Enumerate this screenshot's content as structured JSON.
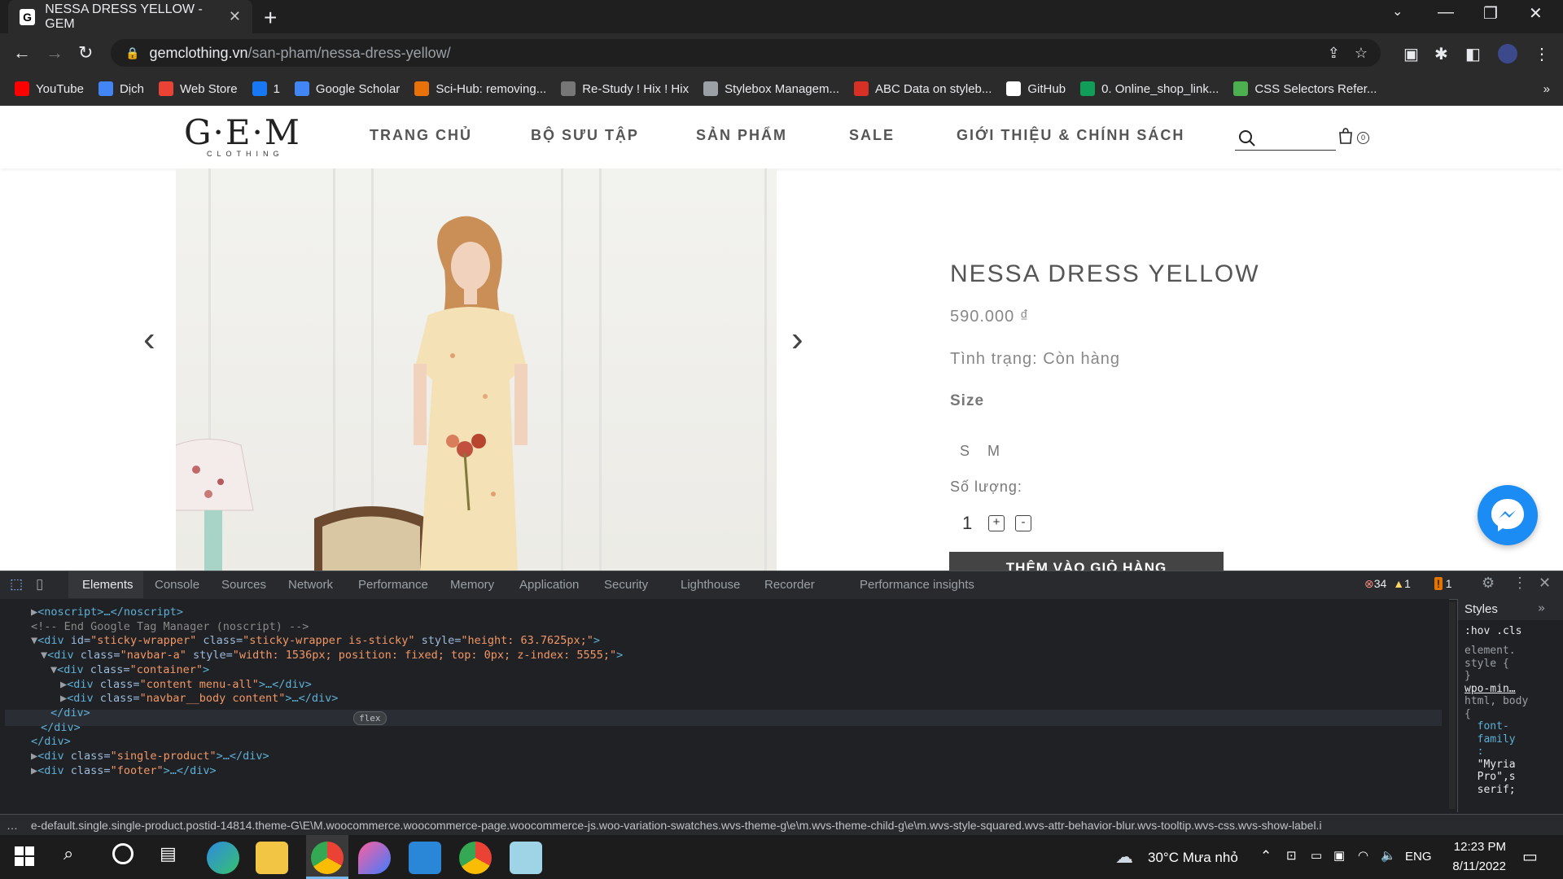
{
  "browser": {
    "tab_title": "NESSA DRESS YELLOW - GEM",
    "tab_favicon": "G",
    "tab_close": "✕",
    "new_tab": "+",
    "url_host": "gemclothing.vn",
    "url_path": "/san-pham/nessa-dress-yellow/",
    "bookmarks": [
      {
        "label": "YouTube",
        "icon": "youtube-icon",
        "color": "#ff0000"
      },
      {
        "label": "Dịch",
        "icon": "translate-icon",
        "color": "#4285f4"
      },
      {
        "label": "Web Store",
        "icon": "webstore-icon",
        "color": "#ea4335"
      },
      {
        "label": "1",
        "icon": "facebook-icon",
        "color": "#1877f2"
      },
      {
        "label": "Google Scholar",
        "icon": "scholar-icon",
        "color": "#4285f4"
      },
      {
        "label": "Sci-Hub: removing...",
        "icon": "scihub-icon",
        "color": "#e8710a"
      },
      {
        "label": "Re-Study ! Hix ! Hix",
        "icon": "restudy-icon",
        "color": "#777777"
      },
      {
        "label": "Stylebox Managem...",
        "icon": "gear-icon",
        "color": "#9aa0a6"
      },
      {
        "label": "ABC Data on styleb...",
        "icon": "abc-icon",
        "color": "#d93025"
      },
      {
        "label": "GitHub",
        "icon": "github-icon",
        "color": "#ffffff"
      },
      {
        "label": "0. Online_shop_link...",
        "icon": "sheets-icon",
        "color": "#0f9d58"
      },
      {
        "label": "CSS Selectors Refer...",
        "icon": "w3-icon",
        "color": "#4caf50"
      }
    ],
    "bookmarks_more": "»"
  },
  "site": {
    "logo": "G·E·M",
    "logo_sub": "CLOTHING",
    "menu": [
      "TRANG CHỦ",
      "BỘ SƯU TẬP",
      "SẢN PHẨM",
      "SALE",
      "GIỚI THIỆU & CHÍNH SÁCH"
    ],
    "cart_count": "0"
  },
  "product": {
    "title": "NESSA DRESS YELLOW",
    "price": "590.000 ₫",
    "status": "Tình trạng: Còn hàng",
    "size_label": "Size",
    "sizes": [
      "S",
      "M"
    ],
    "qty_label": "Số lượng:",
    "qty": "1",
    "plus": "+",
    "minus": "-",
    "add_to_cart": "THÊM VÀO GIỎ HÀNG",
    "prev": "‹",
    "next": "›"
  },
  "devtools": {
    "tabs": [
      "Elements",
      "Console",
      "Sources",
      "Network",
      "Performance",
      "Memory",
      "Application",
      "Security",
      "Lighthouse",
      "Recorder",
      "Performance insights"
    ],
    "errors": "34",
    "warnings": "1",
    "issues": "1",
    "code_lines": [
      {
        "indent": 0,
        "text": "▶<noscript>…</noscript>"
      },
      {
        "indent": 0,
        "text": "<!-- End Google Tag Manager (noscript) -->"
      },
      {
        "indent": 0,
        "text": "▼<div id=\"sticky-wrapper\" class=\"sticky-wrapper is-sticky\" style=\"height: 63.7625px;\">"
      },
      {
        "indent": 1,
        "text": "▼<div class=\"navbar-a\" style=\"width: 1536px; position: fixed; top: 0px; z-index: 5555;\">"
      },
      {
        "indent": 2,
        "text": "▼<div class=\"container\">"
      },
      {
        "indent": 3,
        "text": "▶<div class=\"content menu-all\">…</div>"
      },
      {
        "indent": 3,
        "text": "▶<div class=\"navbar__body content\">…</div>"
      },
      {
        "indent": 2,
        "text": "</div>"
      },
      {
        "indent": 1,
        "text": "</div>"
      },
      {
        "indent": 0,
        "text": "</div>"
      },
      {
        "indent": 0,
        "text": "▶<div class=\"single-product\">…</div>"
      },
      {
        "indent": 0,
        "text": "▶<div class=\"footer\">…</div>"
      }
    ],
    "flex_badge": "flex",
    "styles_tab": "Styles",
    "styles_filter": ":hov  .cls",
    "styles_text": [
      "element.",
      "style {",
      "}",
      "wpo-min…",
      "html, body",
      "{",
      "  font-",
      "  family",
      "  :",
      "  \"Myria",
      "  Pro\",s",
      "  serif;"
    ],
    "breadcrumb": "e-default.single.single-product.postid-14814.theme-G\\E\\M.woocommerce.woocommerce-page.woocommerce-js.woo-variation-swatches.wvs-theme-g\\e\\m.wvs-theme-child-g\\e\\m.wvs-style-squared.wvs-attr-behavior-blur.wvs-tooltip.wvs-css.wvs-show-label.i"
  },
  "taskbar": {
    "weather": "30°C  Mưa nhỏ",
    "lang": "ENG",
    "time": "12:23 PM",
    "date": "8/11/2022"
  }
}
